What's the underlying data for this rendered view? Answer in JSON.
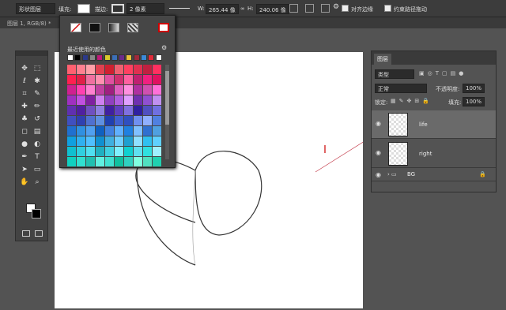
{
  "options_bar": {
    "tool_mode": "形状图层",
    "fill_label": "填充:",
    "stroke_label": "描边:",
    "stroke_width": "2 像素",
    "width_label": "W:",
    "width_value": "265.44 像",
    "height_label": "H:",
    "height_value": "240.06 像",
    "align_edges_label": "对齐边缘",
    "constrain_path_label": "约束路径拖动"
  },
  "document_tab": {
    "label": "图层 1, RGB/8) *"
  },
  "color_picker": {
    "recent_label": "最近使用的颜色",
    "recent_colors": [
      "#ffffff",
      "#000000",
      "#2b3a8a",
      "#888888",
      "#c01a7a",
      "#d9c92a",
      "#3b6fb7",
      "#6b2a8b",
      "#e8c23a",
      "#a02a3a",
      "#3a8ad8",
      "#e02a3a",
      "#ffffff"
    ],
    "grid_colors": [
      [
        "#ff6070",
        "#ff8090",
        "#ffa0a8",
        "#e04050",
        "#d02030",
        "#f06070",
        "#ff4060",
        "#e03050",
        "#c02040",
        "#ff3060"
      ],
      [
        "#ff2050",
        "#e02048",
        "#f070a0",
        "#ff90b0",
        "#e050a0",
        "#d03070",
        "#ff60a0",
        "#c02070",
        "#f02080",
        "#e01060"
      ],
      [
        "#d02090",
        "#ff40b0",
        "#ff80d0",
        "#c040a0",
        "#a02080",
        "#e060c0",
        "#ff90e0",
        "#b030a0",
        "#d050b0",
        "#ff70d8"
      ],
      [
        "#a030c0",
        "#c050e0",
        "#8020a0",
        "#d080f0",
        "#9040c0",
        "#b060e0",
        "#e0a0ff",
        "#7030b0",
        "#9050d0",
        "#c090f0"
      ],
      [
        "#6030b0",
        "#5020a0",
        "#7050c0",
        "#9080e0",
        "#4020a0",
        "#6040c0",
        "#8070e0",
        "#3020a0",
        "#5050c0",
        "#7070e0"
      ],
      [
        "#4050c0",
        "#3040b0",
        "#5070d0",
        "#6090e0",
        "#2040b0",
        "#4060d0",
        "#3050c0",
        "#7090f0",
        "#90b0ff",
        "#5080e0"
      ],
      [
        "#2070d0",
        "#3090e0",
        "#50a0f0",
        "#1060c0",
        "#4080e0",
        "#60b0ff",
        "#2080e0",
        "#80c0ff",
        "#3070d0",
        "#50a0e0"
      ],
      [
        "#10a0e0",
        "#30b0f0",
        "#50c0ff",
        "#1090d0",
        "#40b0e0",
        "#70d0ff",
        "#20a0d0",
        "#90e0ff",
        "#30c0f0",
        "#60d0ff"
      ],
      [
        "#10c0d0",
        "#30d0e0",
        "#50e0f0",
        "#20b0c0",
        "#40d0e0",
        "#80f0ff",
        "#10d0d0",
        "#60e0f0",
        "#30e0e0",
        "#a0f0ff"
      ],
      [
        "#10d0c0",
        "#30e0d0",
        "#20c0b0",
        "#60f0e0",
        "#40e0d0",
        "#10c0a0",
        "#30d0c0",
        "#80ffe0",
        "#50e0c0",
        "#20d0b0"
      ]
    ]
  },
  "toolbar_icons": [
    "move-icon",
    "marquee-icon",
    "lasso-icon",
    "magic-wand-icon",
    "crop-icon",
    "eyedropper-icon",
    "healing-icon",
    "brush-icon",
    "clone-stamp-icon",
    "history-brush-icon",
    "eraser-icon",
    "gradient-icon",
    "blur-icon",
    "dodge-icon",
    "pen-icon",
    "type-icon",
    "path-select-icon",
    "shape-icon",
    "hand-icon",
    "zoom-icon"
  ],
  "layers_panel": {
    "tab_label": "图层",
    "kind_label": "类型",
    "blend_mode": "正常",
    "opacity_label": "不透明度:",
    "opacity_value": "100%",
    "lock_label": "锁定:",
    "fill_label": "填充:",
    "fill_value": "100%",
    "layers": [
      {
        "name": "life"
      },
      {
        "name": "right"
      },
      {
        "name": "BG"
      }
    ]
  }
}
